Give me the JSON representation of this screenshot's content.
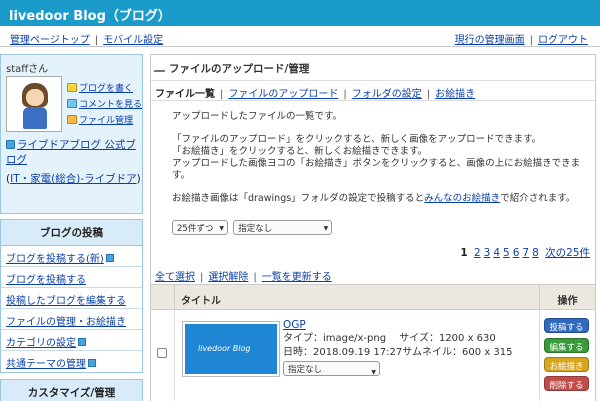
{
  "header": {
    "title": "livedoor Blog（ブログ）",
    "bg_color": "#1a9bc9"
  },
  "subnav": {
    "left": [
      "管理ページトップ",
      "モバイル設定"
    ],
    "right": [
      "現行の管理画面",
      "ログアウト"
    ]
  },
  "user": {
    "name": "staffさん",
    "links": [
      "ブログを書く",
      "コメントを見る",
      "ファイル管理"
    ],
    "blog_name": "ライブドアブログ 公式ブログ",
    "category_prefix": "(",
    "category": "IT・家電(総合)-ライブドア",
    "category_suffix": ")"
  },
  "menu": {
    "heading": "ブログの投稿",
    "items": [
      "ブログを投稿する(新)",
      "ブログを投稿する",
      "投稿したブログを編集する",
      "ファイルの管理・お絵描き",
      "カテゴリの設定",
      "共通テーマの管理"
    ],
    "heading2": "カスタマイズ/管理"
  },
  "main": {
    "title": "ファイルのアップロード/管理",
    "tabs": [
      "ファイル一覧",
      "ファイルのアップロード",
      "フォルダの設定",
      "お絵描き"
    ],
    "desc1": "アップロードしたファイルの一覧です。",
    "desc2": "「ファイルのアップロード」をクリックすると、新しく画像をアップロードできます。",
    "desc3": "「お絵描き」をクリックすると、新しくお絵描きできます。",
    "desc4": "アップロードした画像ヨコの「お絵描き」ボタンをクリックすると、画像の上にお絵描きできます。",
    "desc5a": "お絵描き画像は「drawings」フォルダの設定で投稿すると",
    "desc5link": "みんなのお絵描き",
    "desc5b": "で紹介されます。",
    "per_page": "25件ずつ",
    "filter": "指定なし",
    "pager": {
      "current": "1",
      "pages": [
        "2",
        "3",
        "4",
        "5",
        "6",
        "7",
        "8"
      ],
      "next": "次の25件"
    },
    "actions": [
      "全て選択",
      "選択解除",
      "一覧を更新する"
    ],
    "table": {
      "col_title": "タイトル",
      "col_ops": "操作",
      "rows": [
        {
          "name": "OGP",
          "type": "タイプ：image/x-png　 サイズ：1200 x 630",
          "date": "日時：2018.09.19 17:27サムネイル：600 x 315",
          "folder": "指定なし",
          "thumb_text": "livedoor Blog"
        }
      ],
      "buttons": [
        "投稿する",
        "編集する",
        "お絵描き",
        "削除する"
      ]
    }
  }
}
